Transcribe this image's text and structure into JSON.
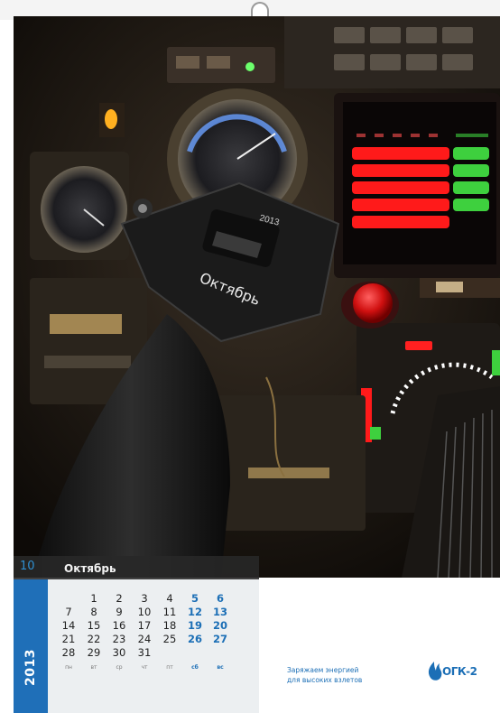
{
  "calendar": {
    "month_number": "10",
    "month_name": "Октябрь",
    "year": "2013",
    "photo_knob_label": "Октябрь",
    "photo_knob_year": "2013",
    "weeks": [
      [
        "",
        "1",
        "2",
        "3",
        "4",
        "5",
        "6"
      ],
      [
        "7",
        "8",
        "9",
        "10",
        "11",
        "12",
        "13"
      ],
      [
        "14",
        "15",
        "16",
        "17",
        "18",
        "19",
        "20"
      ],
      [
        "21",
        "22",
        "23",
        "24",
        "25",
        "26",
        "27"
      ],
      [
        "28",
        "29",
        "30",
        "31",
        "",
        "",
        ""
      ]
    ],
    "weekday_labels": [
      "пн",
      "вт",
      "ср",
      "чт",
      "пт",
      "сб",
      "вс"
    ]
  },
  "footer": {
    "tagline_line1": "Заряжаем энергией",
    "tagline_line2": "для высоких взлетов",
    "brand": "ОГК-2"
  },
  "colors": {
    "accent_blue": "#1f6fb8",
    "weekend_blue": "#1c6fb6",
    "header_dark": "#282828"
  },
  "icons": {
    "logo": "flame-icon"
  }
}
